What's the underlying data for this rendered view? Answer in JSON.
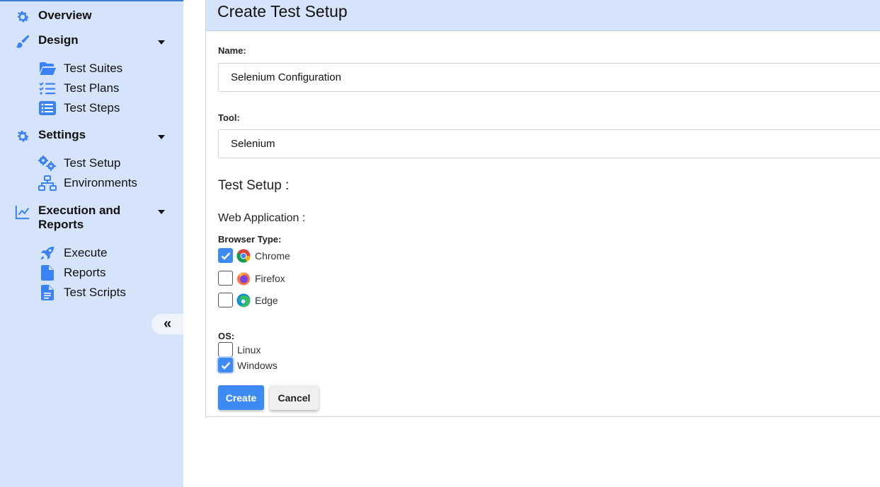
{
  "sidebar": {
    "sections": [
      {
        "label": "Overview",
        "icon": "gear-icon"
      },
      {
        "label": "Design",
        "icon": "paintbrush-icon"
      },
      {
        "label": "Settings",
        "icon": "gear-icon"
      },
      {
        "label": "Execution and Reports",
        "icon": "chart-line-icon"
      }
    ],
    "items": [
      {
        "label": "Test Suites",
        "icon": "folder-open-icon"
      },
      {
        "label": "Test Plans",
        "icon": "checklist-icon"
      },
      {
        "label": "Test Steps",
        "icon": "list-icon"
      },
      {
        "label": "Test Setup",
        "icon": "gears-icon"
      },
      {
        "label": "Environments",
        "icon": "network-icon"
      },
      {
        "label": "Execute",
        "icon": "rocket-icon"
      },
      {
        "label": "Reports",
        "icon": "file-icon"
      },
      {
        "label": "Test Scripts",
        "icon": "file-text-icon"
      }
    ],
    "collapse_glyph": "«"
  },
  "form": {
    "title": "Create Test Setup",
    "name_label": "Name:",
    "name_value": "Selenium Configuration",
    "tool_label": "Tool:",
    "tool_value": "Selenium",
    "section_heading": "Test Setup :",
    "sub_heading": "Web Application :",
    "browser_label": "Browser Type:",
    "browsers": [
      {
        "label": "Chrome",
        "checked": true
      },
      {
        "label": "Firefox",
        "checked": false
      },
      {
        "label": "Edge",
        "checked": false
      }
    ],
    "os_label": "OS:",
    "os": [
      {
        "label": "Linux",
        "checked": false
      },
      {
        "label": "Windows",
        "checked": true
      }
    ],
    "create_label": "Create",
    "cancel_label": "Cancel"
  },
  "colors": {
    "accent": "#3d8bf2",
    "sidebar_bg": "#d6e4fb",
    "icon_blue": "#3b82f6"
  }
}
